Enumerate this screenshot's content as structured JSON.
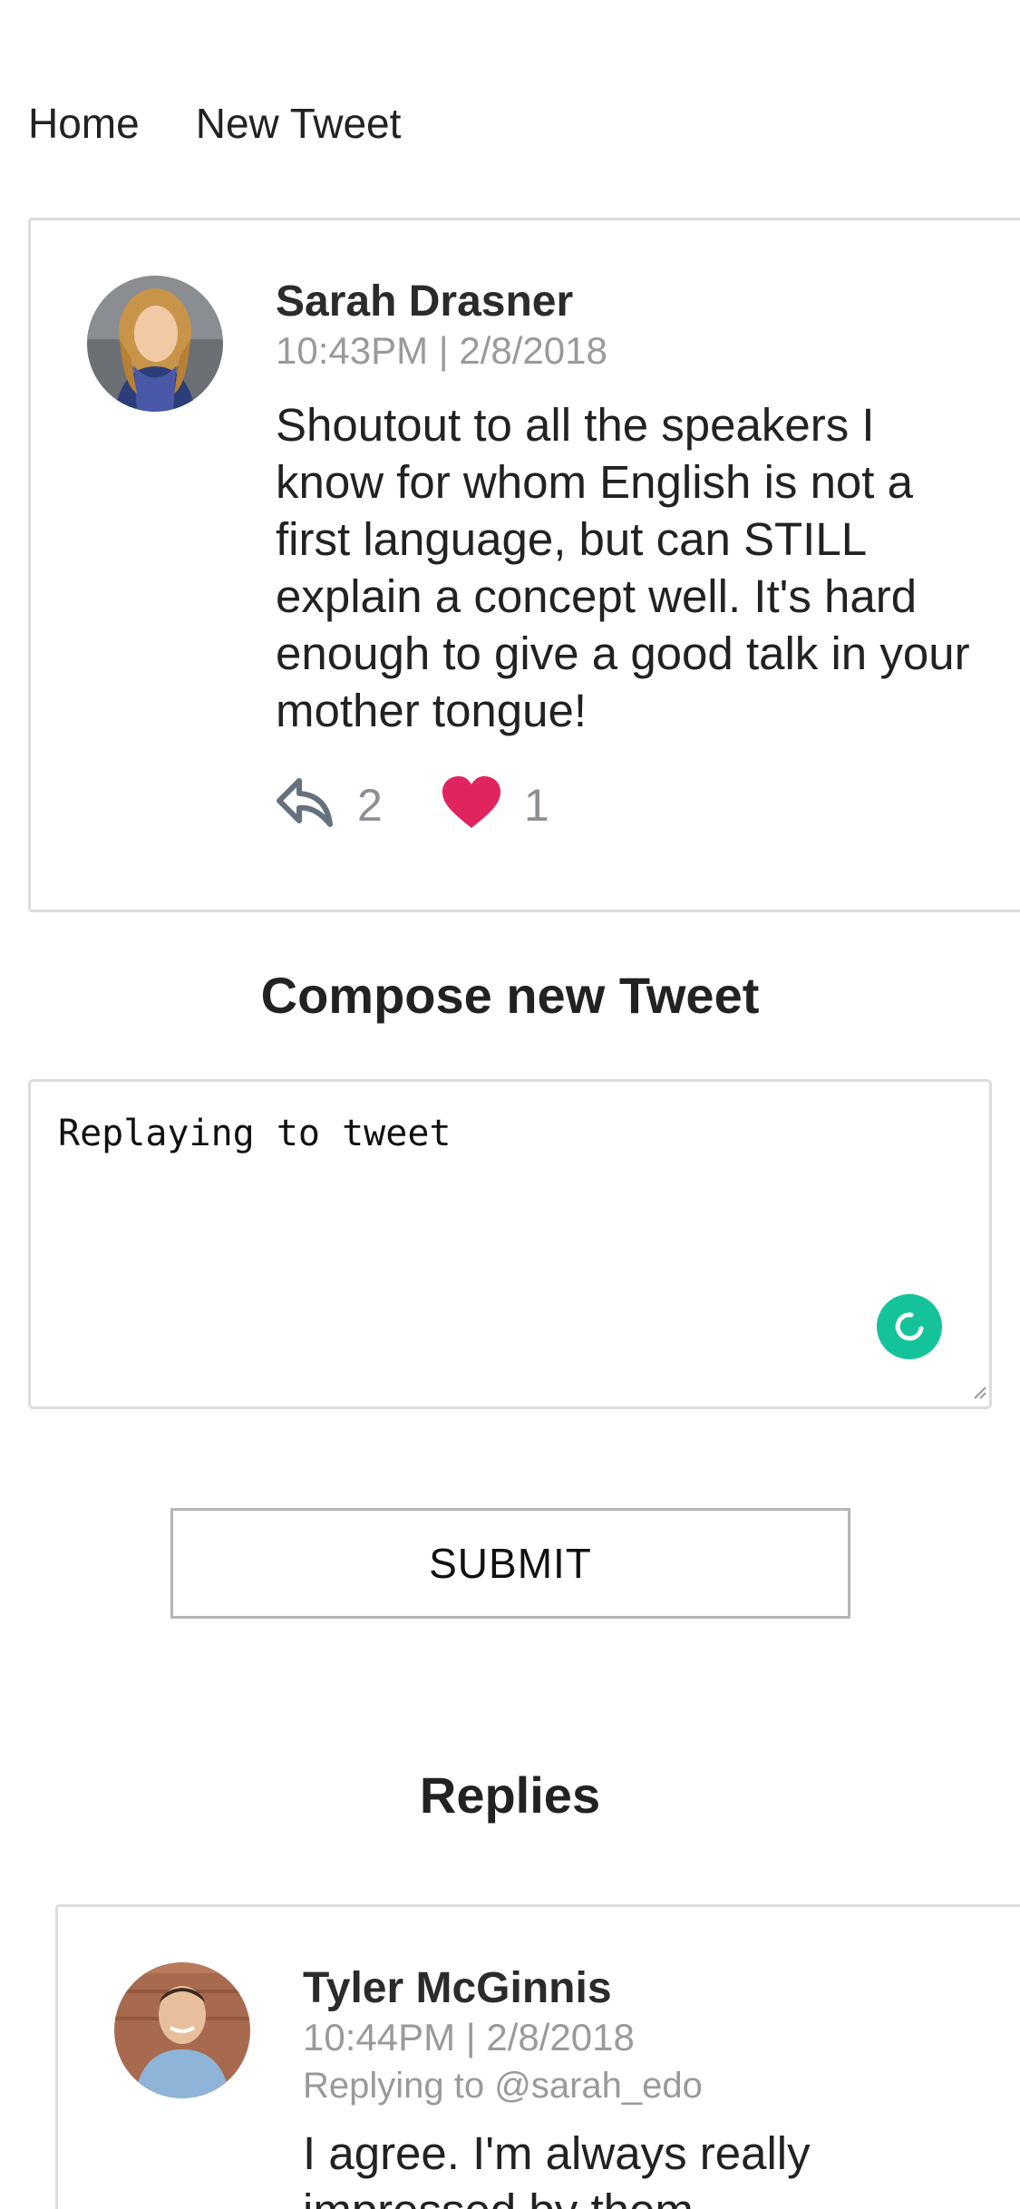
{
  "nav": {
    "home": "Home",
    "new_tweet": "New Tweet"
  },
  "tweet": {
    "author": "Sarah Drasner",
    "timestamp": "10:43PM | 2/8/2018",
    "text": "Shoutout to all the speakers I know for whom English is not a first language, but can STILL explain a concept well. It's hard enough to give a good talk in your mother tongue!",
    "reply_count": "2",
    "like_count": "1",
    "like_color": "#e0245e"
  },
  "compose": {
    "title": "Compose new Tweet",
    "value": "Replaying to tweet",
    "submit_label": "SUBMIT"
  },
  "replies": {
    "title": "Replies",
    "items": [
      {
        "author": "Tyler McGinnis",
        "timestamp": "10:44PM | 2/8/2018",
        "replying_to": "Replying to @sarah_edo",
        "text": "I agree. I'm always really impressed by them."
      }
    ]
  }
}
